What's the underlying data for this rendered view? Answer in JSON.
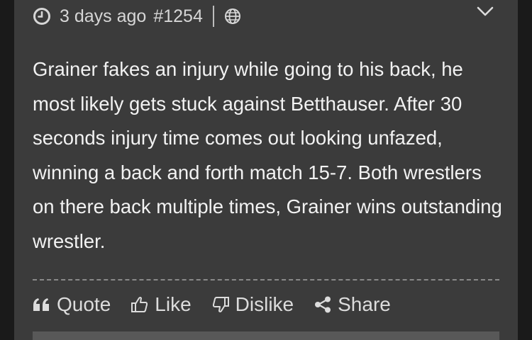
{
  "post": {
    "timestamp": "3 days ago",
    "post_number": "#1254",
    "body": "Grainer fakes an injury while going to his back, he most likely gets stuck against Betthauser. After 30 seconds injury time comes out looking unfazed, winning a back and forth match 15-7. Both wrestlers on there back multiple times, Grainer wins outstanding wrestler."
  },
  "actions": {
    "quote": "Quote",
    "like": "Like",
    "dislike": "Dislike",
    "share": "Share"
  },
  "icons": {
    "clock": "clock-icon",
    "globe": "globe-icon",
    "collapse": "chevron-down-icon",
    "quote": "quote-icon",
    "like": "thumbs-up-icon",
    "dislike": "thumbs-down-icon",
    "share": "share-icon"
  },
  "colors": {
    "card_background": "#3b3b3b",
    "text_primary": "#f2f2f2",
    "text_secondary": "#d6d6d6"
  }
}
